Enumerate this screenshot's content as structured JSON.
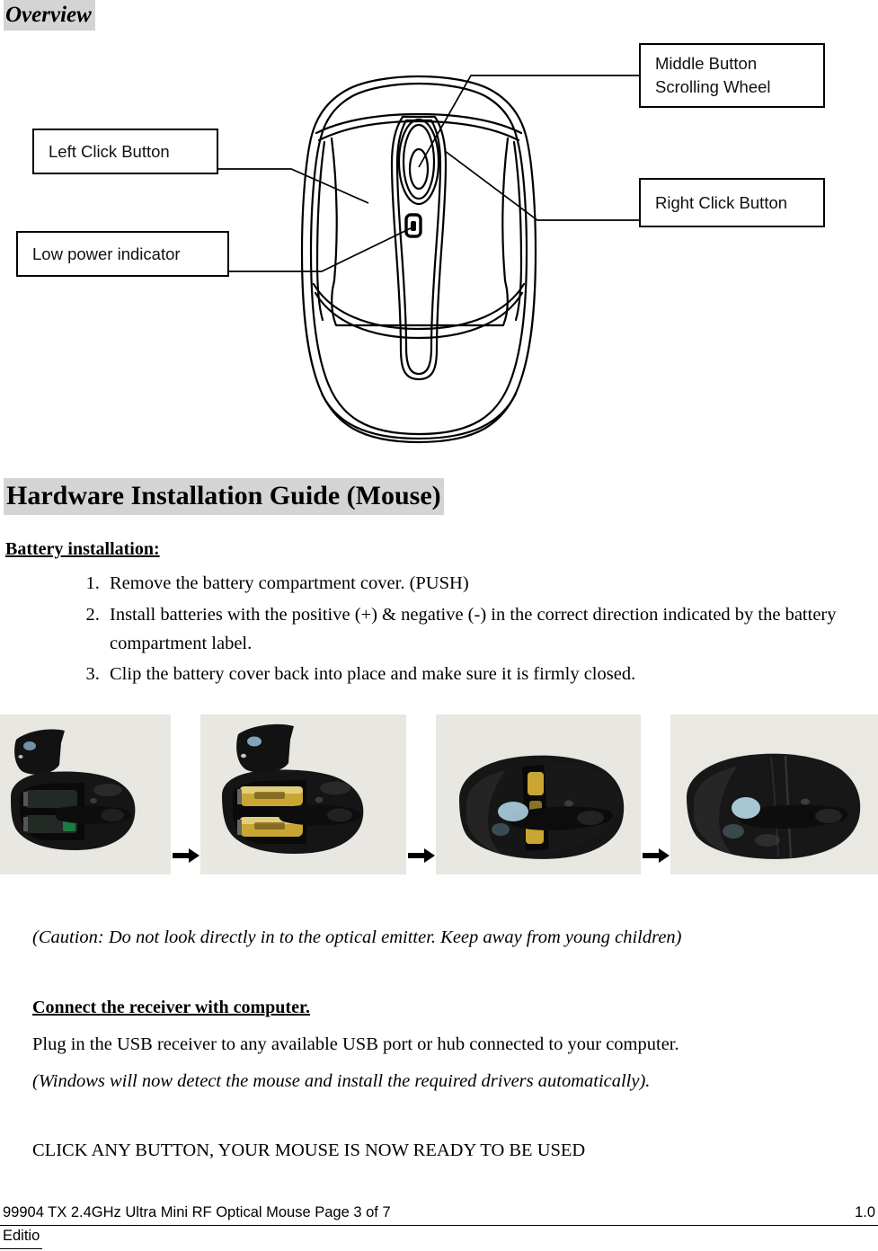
{
  "document": {
    "overview_title": "Overview",
    "section_title": "Hardware Installation Guide (Mouse)"
  },
  "diagram": {
    "callouts": [
      {
        "id": "middle",
        "line1": "Middle Button",
        "line2": "Scrolling Wheel"
      },
      {
        "id": "right",
        "line1": "Right Click Button",
        "line2": ""
      },
      {
        "id": "left",
        "line1": "Left Click Button",
        "line2": ""
      },
      {
        "id": "power",
        "line1": "Low power indicator",
        "line2": ""
      }
    ]
  },
  "battery": {
    "heading": "Battery installation:",
    "steps": [
      "Remove the battery compartment cover. (PUSH)",
      "Install batteries with the positive (+) & negative (-) in the correct direction indicated by the battery compartment label.",
      "Clip the battery cover back into place and make sure it is firmly closed."
    ]
  },
  "photos": {
    "items": [
      {
        "caption": "mouse-cover-removed-empty-bay"
      },
      {
        "caption": "mouse-batteries-installed"
      },
      {
        "caption": "mouse-cover-partially-closed"
      },
      {
        "caption": "mouse-cover-closed"
      }
    ],
    "arrow_icon": "right-arrow-icon"
  },
  "caution": {
    "text": "(Caution: Do not look directly in to the optical emitter. Keep away from young children)"
  },
  "connect": {
    "heading": "Connect the receiver with computer.",
    "line1": "Plug in the USB receiver to any available USB port or hub connected to your computer.",
    "line2": "(Windows will now detect the mouse and install the required drivers automatically).",
    "cta": "CLICK ANY BUTTON, YOUR MOUSE IS NOW READY TO BE USED"
  },
  "footer": {
    "left": "99904 TX 2.4GHz Ultra Mini RF Optical Mouse Page 3 of 7",
    "right": "1.0",
    "second_line": "Editio"
  },
  "colors": {
    "highlight": "#d4d4d4",
    "photo_background": "#e9e7e1",
    "ink": "#000000"
  }
}
